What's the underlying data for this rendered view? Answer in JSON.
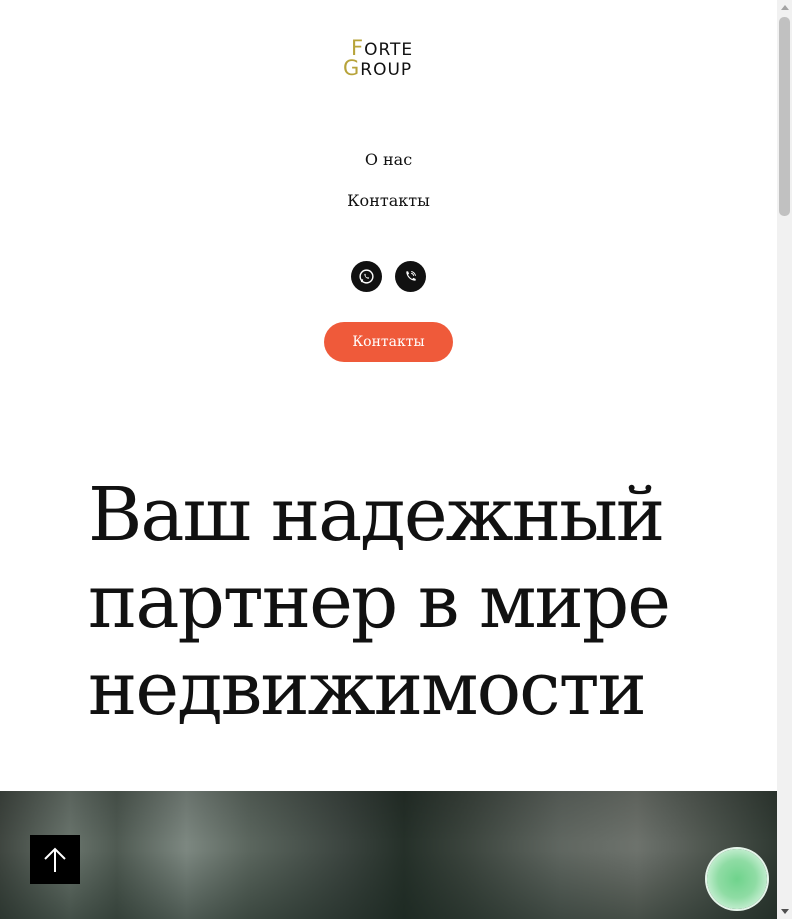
{
  "logo": {
    "top_accent": "F",
    "top_rest": "ORTE",
    "bottom_accent": "G",
    "bottom_rest": "ROUP",
    "accent_color": "#b7a33a"
  },
  "nav": {
    "about": "О нас",
    "contacts": "Контакты"
  },
  "social": {
    "whatsapp_icon": "whatsapp-icon",
    "viber_icon": "viber-icon"
  },
  "cta": {
    "label": "Контакты",
    "color": "#ef5a3a"
  },
  "hero": {
    "title": "Ваш надежный партнер в мире недвижимости"
  },
  "widgets": {
    "scroll_top_icon": "arrow-up-icon",
    "chat_color": "#6fd38c"
  }
}
